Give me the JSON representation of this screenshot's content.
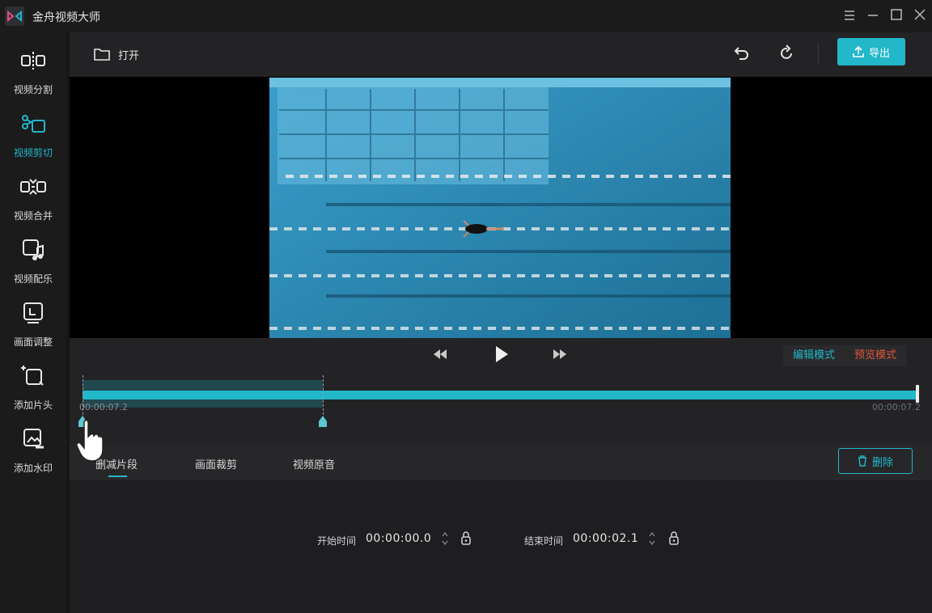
{
  "window": {
    "title": "金舟视频大师",
    "controls": [
      "menu-icon",
      "minimize-icon",
      "maximize-icon",
      "close-icon"
    ]
  },
  "sidebar": {
    "items": [
      {
        "label": "视频分割",
        "icon": "video-split-icon",
        "active": false
      },
      {
        "label": "视频剪切",
        "icon": "video-cut-icon",
        "active": true
      },
      {
        "label": "视频合并",
        "icon": "video-merge-icon",
        "active": false
      },
      {
        "label": "视频配乐",
        "icon": "video-music-icon",
        "active": false
      },
      {
        "label": "画面调整",
        "icon": "picture-adjust-icon",
        "active": false
      },
      {
        "label": "添加片头",
        "icon": "add-intro-icon",
        "active": false
      },
      {
        "label": "添加水印",
        "icon": "add-watermark-icon",
        "active": false
      }
    ]
  },
  "toolbar": {
    "open_label": "打开",
    "export_label": "导出"
  },
  "player": {
    "mode_edit": "编辑模式",
    "mode_preview": "预览模式"
  },
  "timeline": {
    "start_time": "00:00:07.2",
    "end_time": "00:00:07.2",
    "selection_fraction": [
      0.0,
      0.29
    ]
  },
  "tabs": {
    "items": [
      "删减片段",
      "画面裁剪",
      "视频原音"
    ],
    "active_index": 0,
    "delete_label": "删除"
  },
  "panel": {
    "start_label": "开始时间",
    "start_value": "00:00:00.0",
    "end_label": "结束时间",
    "end_value": "00:00:02.1"
  },
  "colors": {
    "accent": "#22b7c9",
    "preview_mode": "#e0553b",
    "background": "#1e1e20"
  }
}
